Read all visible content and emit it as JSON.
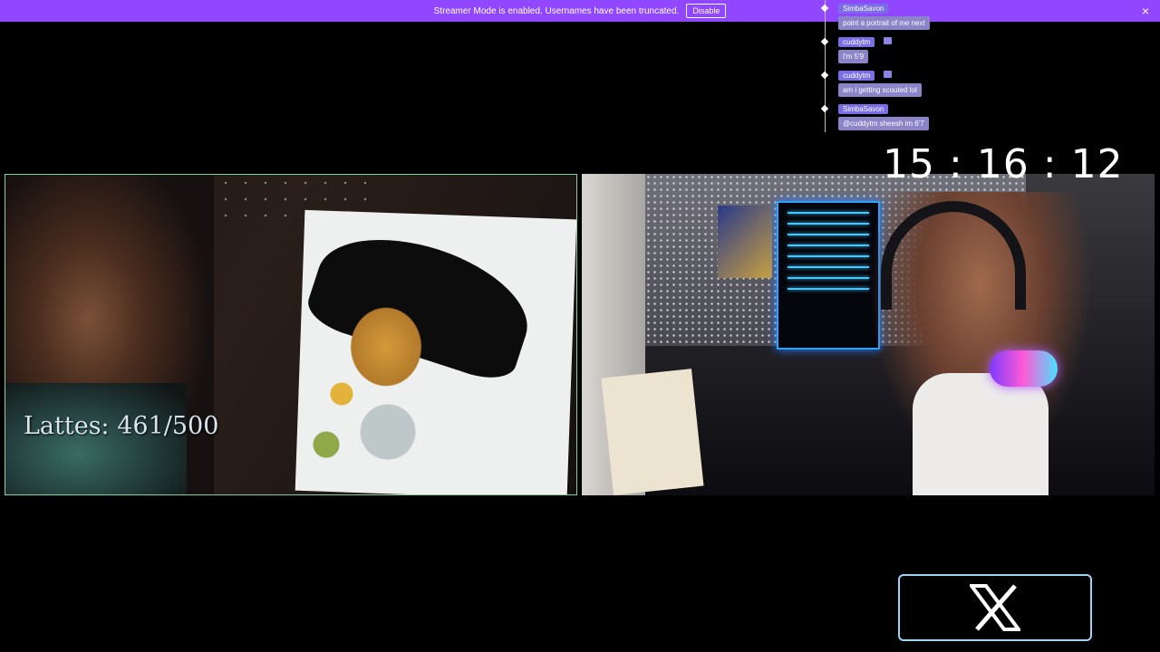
{
  "banner": {
    "message": "Streamer Mode is enabled. Usernames have been truncated.",
    "disable_label": "Disable",
    "close_glyph": "×",
    "color": "#9147ff"
  },
  "chat": {
    "messages": [
      {
        "user": "SimbaSavon",
        "text": "point a portrait of me next",
        "has_badge": false
      },
      {
        "user": "cuddytm",
        "text": "I'm 5'9",
        "has_badge": true
      },
      {
        "user": "cuddytm",
        "text": "am i getting scouted lol",
        "has_badge": true
      },
      {
        "user": "SimbaSavon",
        "text": "@cuddytm sheesh im 6'7",
        "has_badge": false
      }
    ]
  },
  "clock": {
    "time": "15 : 16 : 12"
  },
  "overlay": {
    "lattes": "Lattes: 461/500"
  },
  "social": {
    "icon": "x-logo-icon"
  }
}
